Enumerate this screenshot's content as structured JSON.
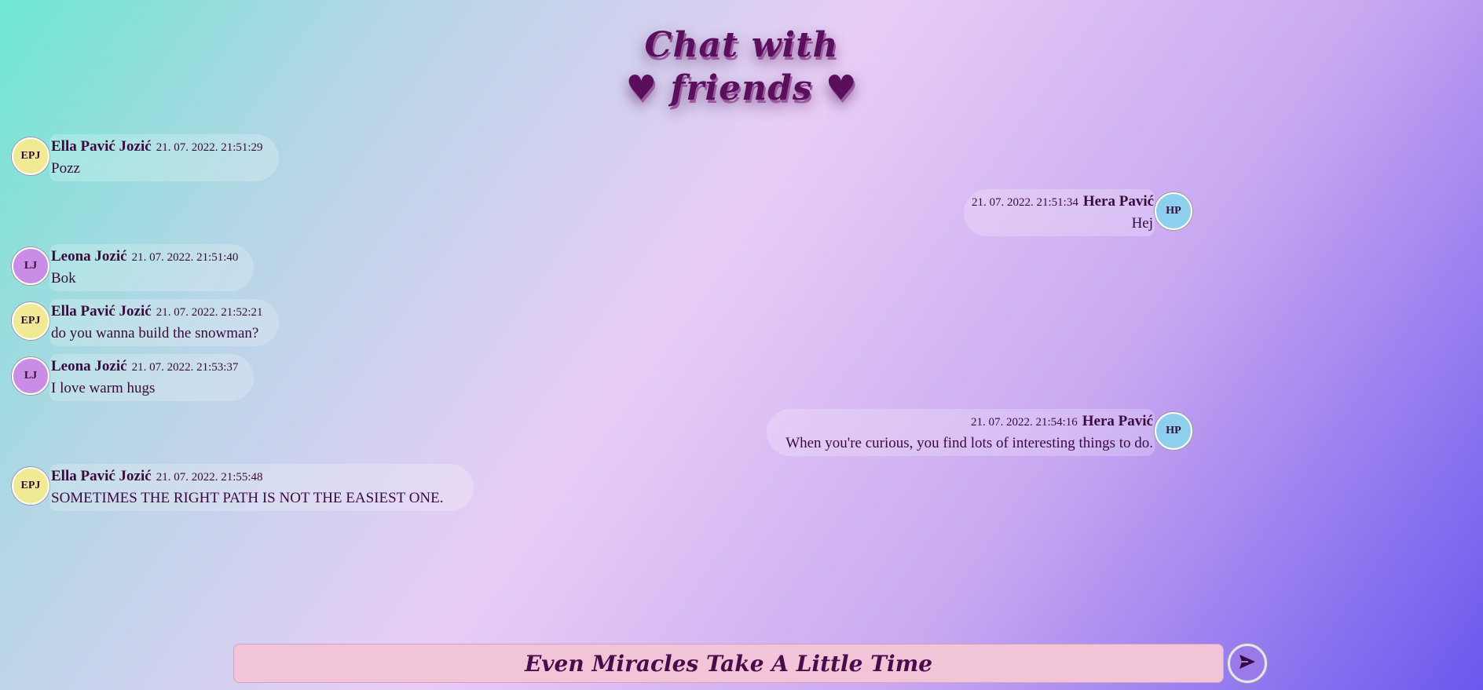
{
  "title": {
    "line1": "Chat with",
    "line2": "♥ friends ♥"
  },
  "messages": [
    {
      "initials": "EPJ",
      "name": "Ella Pavić Jozić",
      "time": "21. 07. 2022. 21:51:29",
      "text": "Pozz",
      "side": "left",
      "color": "#f1ea94"
    },
    {
      "initials": "HP",
      "name": "Hera Pavić",
      "time": "21. 07. 2022. 21:51:34",
      "text": "Hej",
      "side": "right",
      "color": "#8ecfee"
    },
    {
      "initials": "LJ",
      "name": "Leona Jozić",
      "time": "21. 07. 2022. 21:51:40",
      "text": "Bok",
      "side": "left",
      "color": "#c98de6"
    },
    {
      "initials": "EPJ",
      "name": "Ella Pavić Jozić",
      "time": "21. 07. 2022. 21:52:21",
      "text": "do you wanna build the snowman?",
      "side": "left",
      "color": "#f1ea94"
    },
    {
      "initials": "LJ",
      "name": "Leona Jozić",
      "time": "21. 07. 2022. 21:53:37",
      "text": "I love warm hugs",
      "side": "left",
      "color": "#c98de6"
    },
    {
      "initials": "HP",
      "name": "Hera Pavić",
      "time": "21. 07. 2022. 21:54:16",
      "text": "When you're curious, you find lots of interesting things to do.",
      "side": "right",
      "color": "#8ecfee"
    },
    {
      "initials": "EPJ",
      "name": "Ella Pavić Jozić",
      "time": "21. 07. 2022. 21:55:48",
      "text": "SOMETIMES THE RIGHT PATH IS NOT THE EASIEST ONE.",
      "side": "left",
      "color": "#f1ea94"
    }
  ],
  "composer": {
    "placeholder": "Even Miracles Take A Little Time"
  },
  "send_icon": "send-icon",
  "accent_color": "#5a0f5c"
}
